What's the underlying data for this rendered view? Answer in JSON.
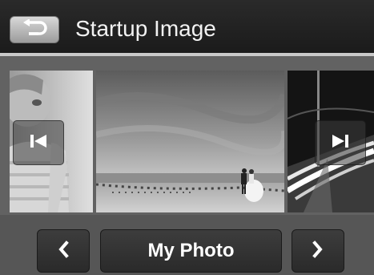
{
  "header": {
    "title": "Startup Image",
    "back_icon": "return-arrow-icon"
  },
  "gallery": {
    "images": [
      {
        "subject": "child portrait",
        "grayscale": true
      },
      {
        "subject": "couple on beach",
        "grayscale": true
      },
      {
        "subject": "light trails on road at night",
        "grayscale": true
      }
    ],
    "prev_icon": "skip-previous-icon",
    "next_icon": "skip-next-icon"
  },
  "selector": {
    "current_label": "My Photo",
    "prev_icon": "chevron-left-icon",
    "next_icon": "chevron-right-icon"
  },
  "colors": {
    "title_bar": "#1f1f1f",
    "background": "#4a4a4a",
    "separator": "#c9c9c9",
    "button": "#333333",
    "text": "#ffffff"
  }
}
